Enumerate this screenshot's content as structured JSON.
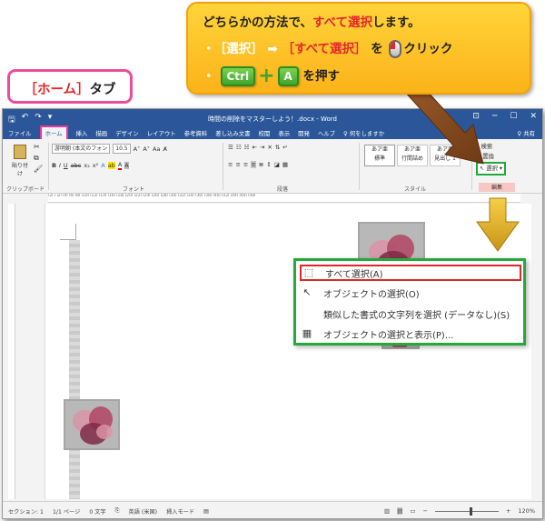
{
  "callout_main": {
    "line1_prefix": "どちらかの方法で、",
    "line1_highlight": "すべて選択",
    "line1_suffix": "します。",
    "line2_part1": "［選択］",
    "line2_arrow": "➡",
    "line2_part2": "［すべて選択］",
    "line2_mid": "を",
    "line2_suffix": "クリック",
    "line3_key1": "Ctrl",
    "line3_plus": "+",
    "line3_key2": "A",
    "line3_suffix": "を押す"
  },
  "callout_home": {
    "bracket_left": "［",
    "label": "ホーム",
    "bracket_right": "］",
    "suffix": "タブ"
  },
  "title_bar": {
    "document_title": "時間の削除をマスターしよう！.docx - Word",
    "qat_save": "🖫",
    "qat_undo": "↶",
    "qat_redo": "↷",
    "qat_more": "▾",
    "win_ribbon": "⊡",
    "win_min": "─",
    "win_max": "☐",
    "win_close": "✕"
  },
  "menu_tabs": [
    "ファイル",
    "ホーム",
    "挿入",
    "描画",
    "デザイン",
    "レイアウト",
    "参考資料",
    "差し込み文書",
    "校閲",
    "表示",
    "開発",
    "ヘルプ"
  ],
  "tell_me": "♀ 何をしますか",
  "share": "♀ 共有",
  "ribbon": {
    "paste_label": "貼り付け",
    "clipboard_group": "クリップボード",
    "font_name": "游明朝 (本文のフォン",
    "font_size": "10.5",
    "font_group": "フォント",
    "paragraph_group": "段落",
    "style_group": "スタイル",
    "styles": [
      {
        "preview": "あア亜",
        "name": "標準"
      },
      {
        "preview": "あア亜",
        "name": "行間詰め"
      },
      {
        "preview": "あア亜",
        "name": "見出し 1"
      }
    ],
    "find": "検索",
    "replace": "置換",
    "select": "選択",
    "edit_group": "編集"
  },
  "dropdown": {
    "items": [
      {
        "label": "すべて選択(A)",
        "icon": "⬚"
      },
      {
        "label": "オブジェクトの選択(O)",
        "icon": "↖"
      },
      {
        "label": "類似した書式の文字列を選択 (データなし)(S)",
        "icon": ""
      },
      {
        "label": "オブジェクトの選択と表示(P)...",
        "icon": "▦"
      }
    ]
  },
  "ruler_text": "l2l l l2l l4l l6l l8l l10l l12l l14l l16l l18l l20l l22l l24l l26l l28l l30l l32l l34l l36l l38l l40l l42l l44l l46l l48l",
  "status_bar": {
    "section": "セクション: 1",
    "page": "1/1 ページ",
    "words": "0 文字",
    "language": "英語 (米国)",
    "mode": "挿入モード",
    "zoom": "120%"
  },
  "colors": {
    "word_blue": "#2b579a",
    "callout_yellow": "#fbb319",
    "highlight_red": "#e4262a",
    "green": "#27a83a",
    "pink": "#ee4c9a"
  }
}
